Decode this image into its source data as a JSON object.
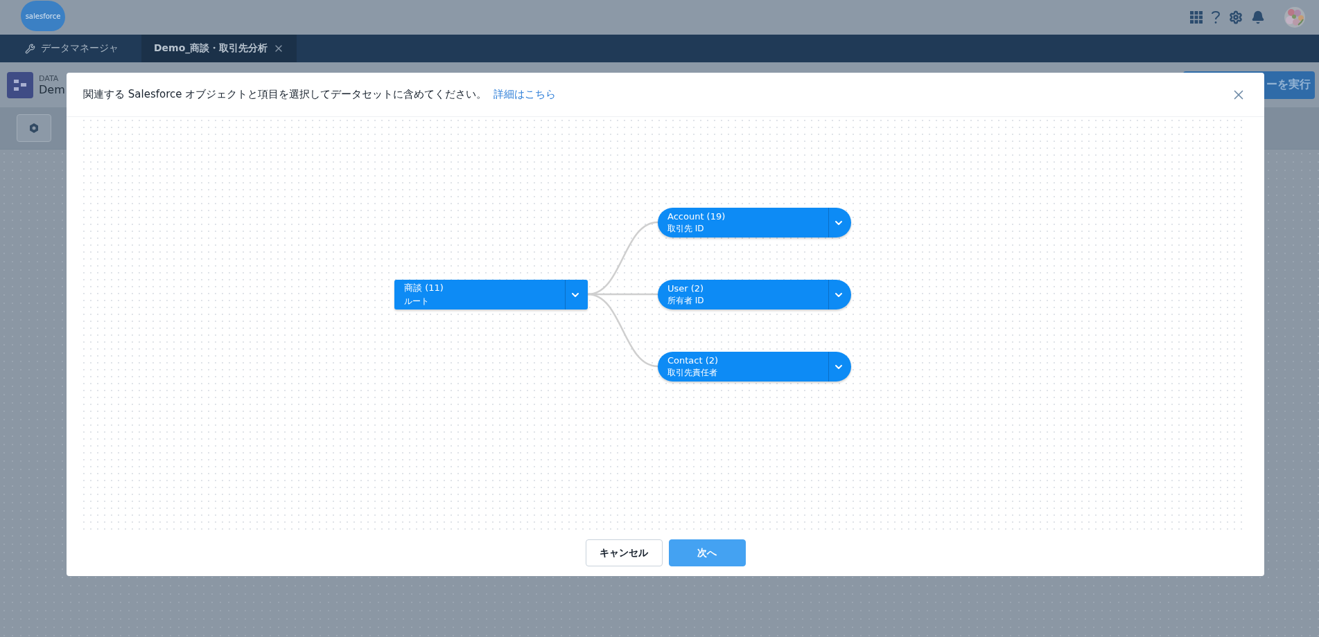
{
  "app_header": {
    "logo": "salesforce"
  },
  "tabs": [
    {
      "label": "データマネージャ",
      "selected": false,
      "closable": false
    },
    {
      "label": "Demo_商談・取引先分析",
      "selected": true,
      "closable": true
    }
  ],
  "page_header": {
    "label": "DATA",
    "title": "Dem",
    "action": "ーを実行"
  },
  "modal": {
    "message": "関連する Salesforce オブジェクトと項目を選択してデータセットに含めてください。",
    "link": "詳細はこちら",
    "root": {
      "name": "商談 (11)",
      "relation": "ルート",
      "children": [
        {
          "name": "Account (19)",
          "relation": "取引先 ID"
        },
        {
          "name": "User (2)",
          "relation": "所有者 ID"
        },
        {
          "name": "Contact (2)",
          "relation": "取引先責任者"
        }
      ]
    },
    "buttons": [
      {
        "label": "キャンセル",
        "kind": "secondary"
      },
      {
        "label": "次へ",
        "kind": "primary"
      }
    ]
  }
}
